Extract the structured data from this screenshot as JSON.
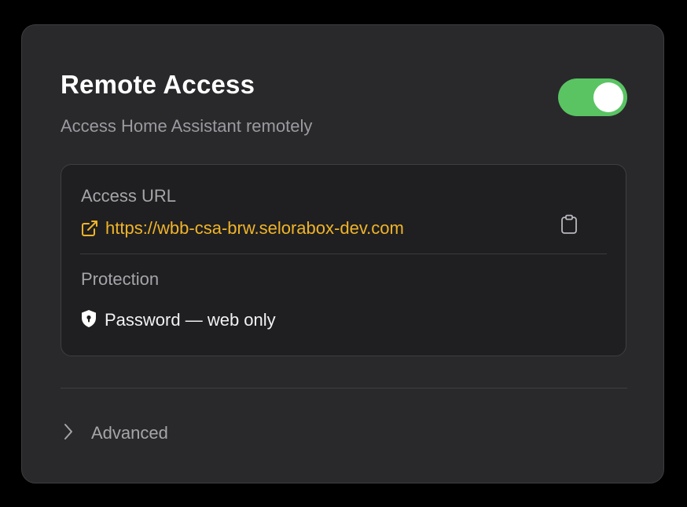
{
  "card": {
    "title": "Remote Access",
    "subtitle": "Access Home Assistant remotely",
    "toggle": {
      "state": "on",
      "color": "#5ac463"
    }
  },
  "details": {
    "access_url_label": "Access URL",
    "access_url": "https://wbb-csa-brw.selorabox-dev.com",
    "url_icon": "external-link-icon",
    "copy_icon": "clipboard-icon",
    "protection_label": "Protection",
    "protection_value": "Password — web only",
    "protection_icon": "shield-lock-icon"
  },
  "advanced": {
    "label": "Advanced",
    "icon": "chevron-right-icon",
    "expanded": false
  },
  "colors": {
    "background": "#000000",
    "card": "#29292b",
    "inner_panel": "#1f1f21",
    "accent_url": "#f0b429",
    "toggle_on": "#5ac463"
  }
}
